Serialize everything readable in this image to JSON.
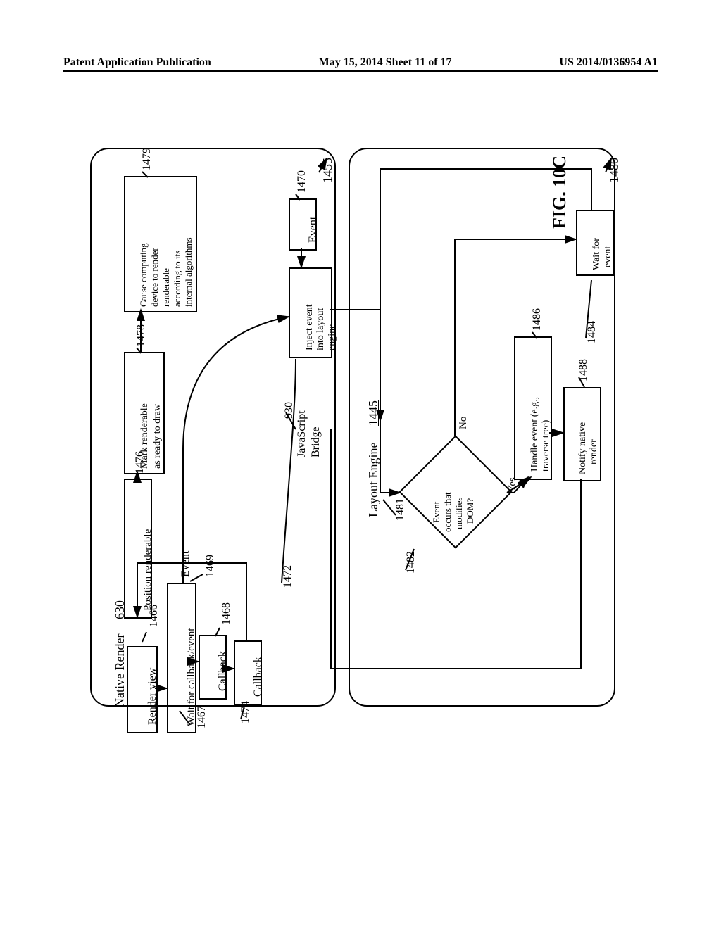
{
  "header": {
    "left": "Patent Application Publication",
    "middle": "May 15, 2014  Sheet 11 of 17",
    "right": "US 2014/0136954 A1"
  },
  "figure_title": "FIG. 10C",
  "left_panel": {
    "title": "Native Render",
    "ref": "630",
    "pointer": "1455",
    "boxes": {
      "render_view": "Render view",
      "wait_cb": "Wait for callback/event",
      "callback_upper": "Callback",
      "callback_lower": "Callback",
      "event_upper": "Event",
      "event_lower": "Event",
      "inject": "Inject event into layout engine",
      "position_renderable": "Position renderable",
      "mark_ready": "Mark renderable as ready to draw",
      "cause_compute": "Cause computing device to render renderable according to its internal algorithms",
      "js_bridge_u": "JavaScript",
      "js_bridge_l": "Bridge"
    },
    "refs": {
      "render_view": "1466",
      "wait_cb": "1467",
      "callback_upper": "1468",
      "event_upper": "1469",
      "event_lower": "1470",
      "inject": "1472",
      "callback_lower": "1474",
      "position_renderable": "1476",
      "mark_ready": "1478",
      "cause_compute": "1479",
      "js_bridge": "930"
    }
  },
  "right_panel": {
    "title": "Layout Engine",
    "ref": "1445",
    "pointer": "1480",
    "decision": "Event occurs that modifies DOM?",
    "yes": "Yes",
    "no": "No",
    "boxes": {
      "wait_event": "Wait for event",
      "handle_event": "Handle event (e.g., traverse tree)",
      "notify": "Notify native render"
    },
    "refs": {
      "loop": "1481",
      "decision": "1482",
      "wait_event": "1484",
      "handle_event": "1486",
      "notify": "1488"
    }
  }
}
